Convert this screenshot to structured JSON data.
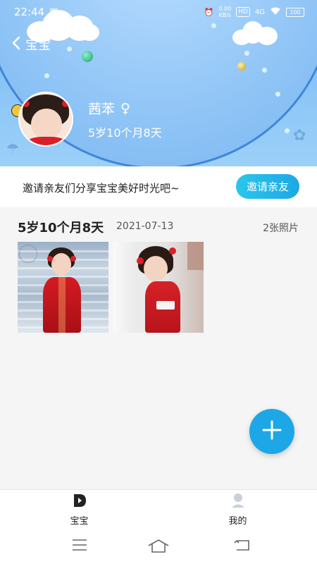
{
  "status_bar": {
    "time": "22:44",
    "net_speed": "0.00",
    "net_unit": "KB/s",
    "hd": "HD",
    "signal": "4G",
    "battery": "100"
  },
  "nav": {
    "back_label": "宝宝"
  },
  "profile": {
    "name": "茜苯",
    "gender_symbol": "♀",
    "age": "5岁10个月8天"
  },
  "invite": {
    "text": "邀请亲友们分享宝宝美好时光吧~",
    "button_label": "邀请亲友"
  },
  "timeline": [
    {
      "age": "5岁10个月8天",
      "date": "2021-07-13",
      "count": "2张照片"
    }
  ],
  "bottom_nav": {
    "tab_baby": "宝宝",
    "tab_mine": "我的"
  },
  "colors": {
    "accent": "#1da7e6",
    "header_bg": "#8ec7f7"
  }
}
